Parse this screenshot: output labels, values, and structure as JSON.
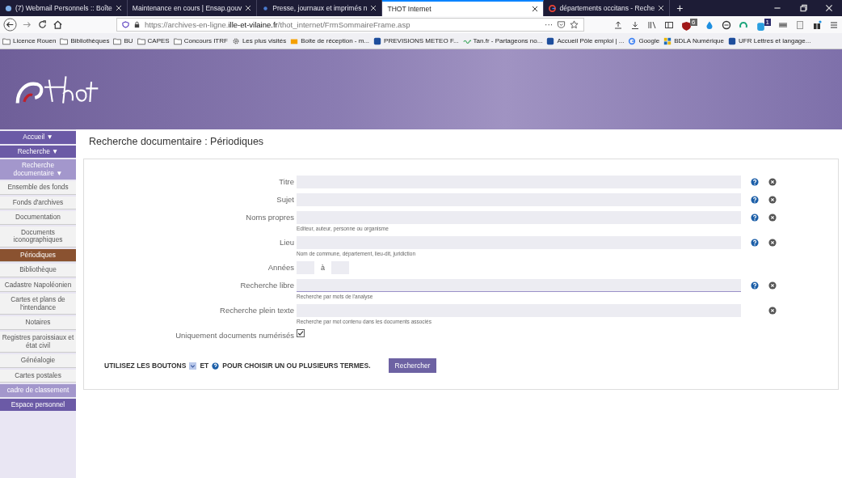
{
  "browser": {
    "tabs": [
      {
        "title": "(7) Webmail Personnels :: Boîte",
        "kind": "globe",
        "selected": false
      },
      {
        "title": "Maintenance en cours | Ensap.gouv",
        "kind": "plain",
        "selected": false
      },
      {
        "title": "Presse, journaux et imprimés n",
        "kind": "dot",
        "selected": false
      },
      {
        "title": "THOT Internet",
        "kind": "plain",
        "selected": true
      },
      {
        "title": "départements occitans - Reche",
        "kind": "google",
        "selected": false
      }
    ],
    "new_tab": "+",
    "url": {
      "prefix": "https://archives-en-ligne.",
      "domain": "ille-et-vilaine.fr",
      "path": "/thot_internet/FrmSommaireFrame.asp"
    },
    "url_menu": "···",
    "extension_badges": [
      "6",
      "1"
    ],
    "bookmarks": [
      {
        "label": "Licence Rouen",
        "kind": "folder"
      },
      {
        "label": "Bibliothèques",
        "kind": "folder"
      },
      {
        "label": "BU",
        "kind": "folder"
      },
      {
        "label": "CAPES",
        "kind": "folder"
      },
      {
        "label": "Concours ITRF",
        "kind": "folder"
      },
      {
        "label": "Les plus visités",
        "kind": "gear"
      },
      {
        "label": "Boite de réception - m...",
        "kind": "mail"
      },
      {
        "label": "PREVISIONS METEO F...",
        "kind": "site"
      },
      {
        "label": "Tan.fr - Partageons no...",
        "kind": "wave"
      },
      {
        "label": "Accueil Pôle emploi | ...",
        "kind": "site"
      },
      {
        "label": "Google",
        "kind": "google"
      },
      {
        "label": "BDLA Numérique",
        "kind": "grid"
      },
      {
        "label": "UFR Lettres et langage...",
        "kind": "site"
      }
    ]
  },
  "sidebar": {
    "items": [
      {
        "label": "Accueil ▼",
        "kind": "header",
        "selected": false
      },
      {
        "label": "Recherche ▼",
        "kind": "header",
        "selected": false
      },
      {
        "label": "Recherche documentaire ▼",
        "kind": "sub",
        "selected": false
      },
      {
        "label": "Ensemble des fonds",
        "kind": "item",
        "selected": false
      },
      {
        "label": "Fonds d'archives",
        "kind": "item",
        "selected": false
      },
      {
        "label": "Documentation",
        "kind": "item",
        "selected": false
      },
      {
        "label": "Documents iconographiques",
        "kind": "item",
        "selected": false
      },
      {
        "label": "Périodiques",
        "kind": "item",
        "selected": true
      },
      {
        "label": "Bibliothèque",
        "kind": "item",
        "selected": false
      },
      {
        "label": "Cadastre Napoléonien",
        "kind": "item",
        "selected": false
      },
      {
        "label": "Cartes et plans de l'intendance",
        "kind": "item",
        "selected": false
      },
      {
        "label": "Notaires",
        "kind": "item",
        "selected": false
      },
      {
        "label": "Registres paroissiaux et état civil",
        "kind": "item",
        "selected": false
      },
      {
        "label": "Généalogie",
        "kind": "item",
        "selected": false
      },
      {
        "label": "Cartes postales",
        "kind": "item",
        "selected": false
      },
      {
        "label": "cadre de classement",
        "kind": "sub",
        "selected": false
      },
      {
        "label": "Espace personnel",
        "kind": "header",
        "selected": false
      }
    ]
  },
  "page": {
    "title": "Recherche documentaire : Périodiques",
    "fields": [
      {
        "kind": "text",
        "label": "Titre",
        "help": true,
        "clear": true
      },
      {
        "kind": "text",
        "label": "Sujet",
        "help": true,
        "clear": true
      },
      {
        "kind": "text",
        "label": "Noms propres",
        "hint": "Editeur, auteur, personne ou organisme",
        "help": true,
        "clear": true
      },
      {
        "kind": "text",
        "label": "Lieu",
        "hint": "Nom de commune, département, lieu-dit, juridiction",
        "help": true,
        "clear": true
      },
      {
        "kind": "range",
        "label": "Années",
        "separator": "à"
      },
      {
        "kind": "text",
        "label": "Recherche libre",
        "hint": "Recherche par mots de l'analyse",
        "help": true,
        "clear": true,
        "focused": true
      },
      {
        "kind": "text",
        "label": "Recherche plein texte",
        "hint": "Recherche par mot contenu dans les documents associés",
        "help": false,
        "clear": true
      },
      {
        "kind": "checkbox",
        "label": "Uniquement documents numérisés",
        "checked": true
      }
    ],
    "instruction": {
      "before": "UTILISEZ LES BOUTONS",
      "middle": "ET",
      "after": "POUR CHOISIR UN OU PLUSIEURS TERMES."
    },
    "search_button": "Rechercher"
  }
}
